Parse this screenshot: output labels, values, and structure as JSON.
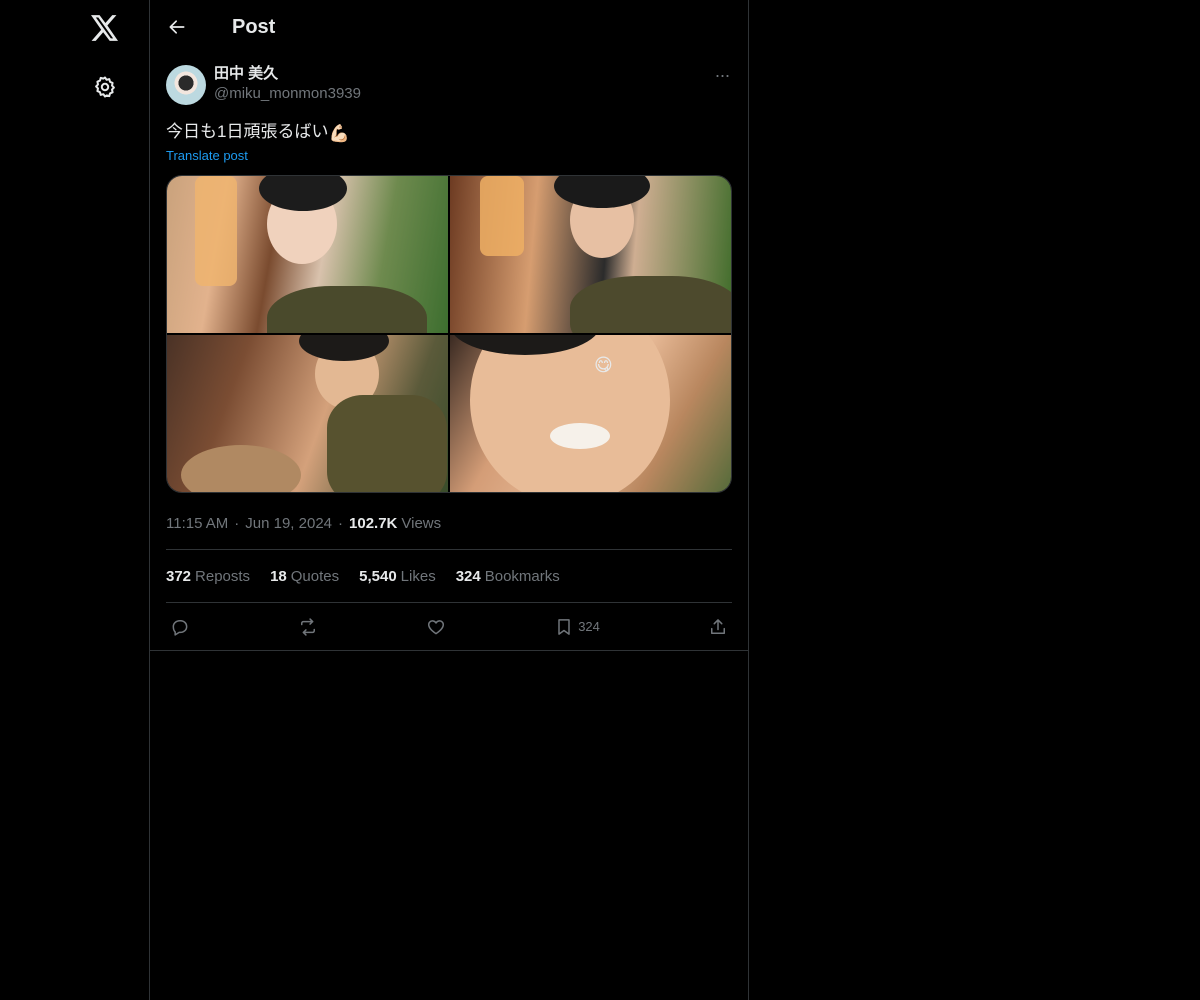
{
  "nav": {
    "logo_icon": "x-logo-icon",
    "settings_icon": "gear-icon"
  },
  "header": {
    "back_icon": "arrow-left-icon",
    "title": "Post"
  },
  "post": {
    "author": {
      "display_name": "田中 美久",
      "handle": "@miku_monmon3939"
    },
    "more_label": "···",
    "text": "今日も1日頑張るばい",
    "text_emoji": "💪🏻",
    "translate_label": "Translate post",
    "media": [
      {
        "alt": "photo 1"
      },
      {
        "alt": "photo 2"
      },
      {
        "alt": "photo 3"
      },
      {
        "alt": "photo 4",
        "sticker": "😋"
      }
    ],
    "time": "11:15 AM",
    "date": "Jun 19, 2024",
    "views_count": "102.7K",
    "views_label": "Views",
    "stats": [
      {
        "count": "372",
        "label": "Reposts"
      },
      {
        "count": "18",
        "label": "Quotes"
      },
      {
        "count": "5,540",
        "label": "Likes"
      },
      {
        "count": "324",
        "label": "Bookmarks"
      }
    ],
    "actions": {
      "reply_icon": "reply-icon",
      "repost_icon": "repost-icon",
      "like_icon": "heart-icon",
      "bookmark_icon": "bookmark-icon",
      "bookmark_count": "324",
      "share_icon": "share-icon"
    }
  },
  "colors": {
    "background": "#000000",
    "text_primary": "#e7e9ea",
    "text_secondary": "#71767b",
    "link": "#1d9bf0",
    "border": "#2f3336"
  }
}
